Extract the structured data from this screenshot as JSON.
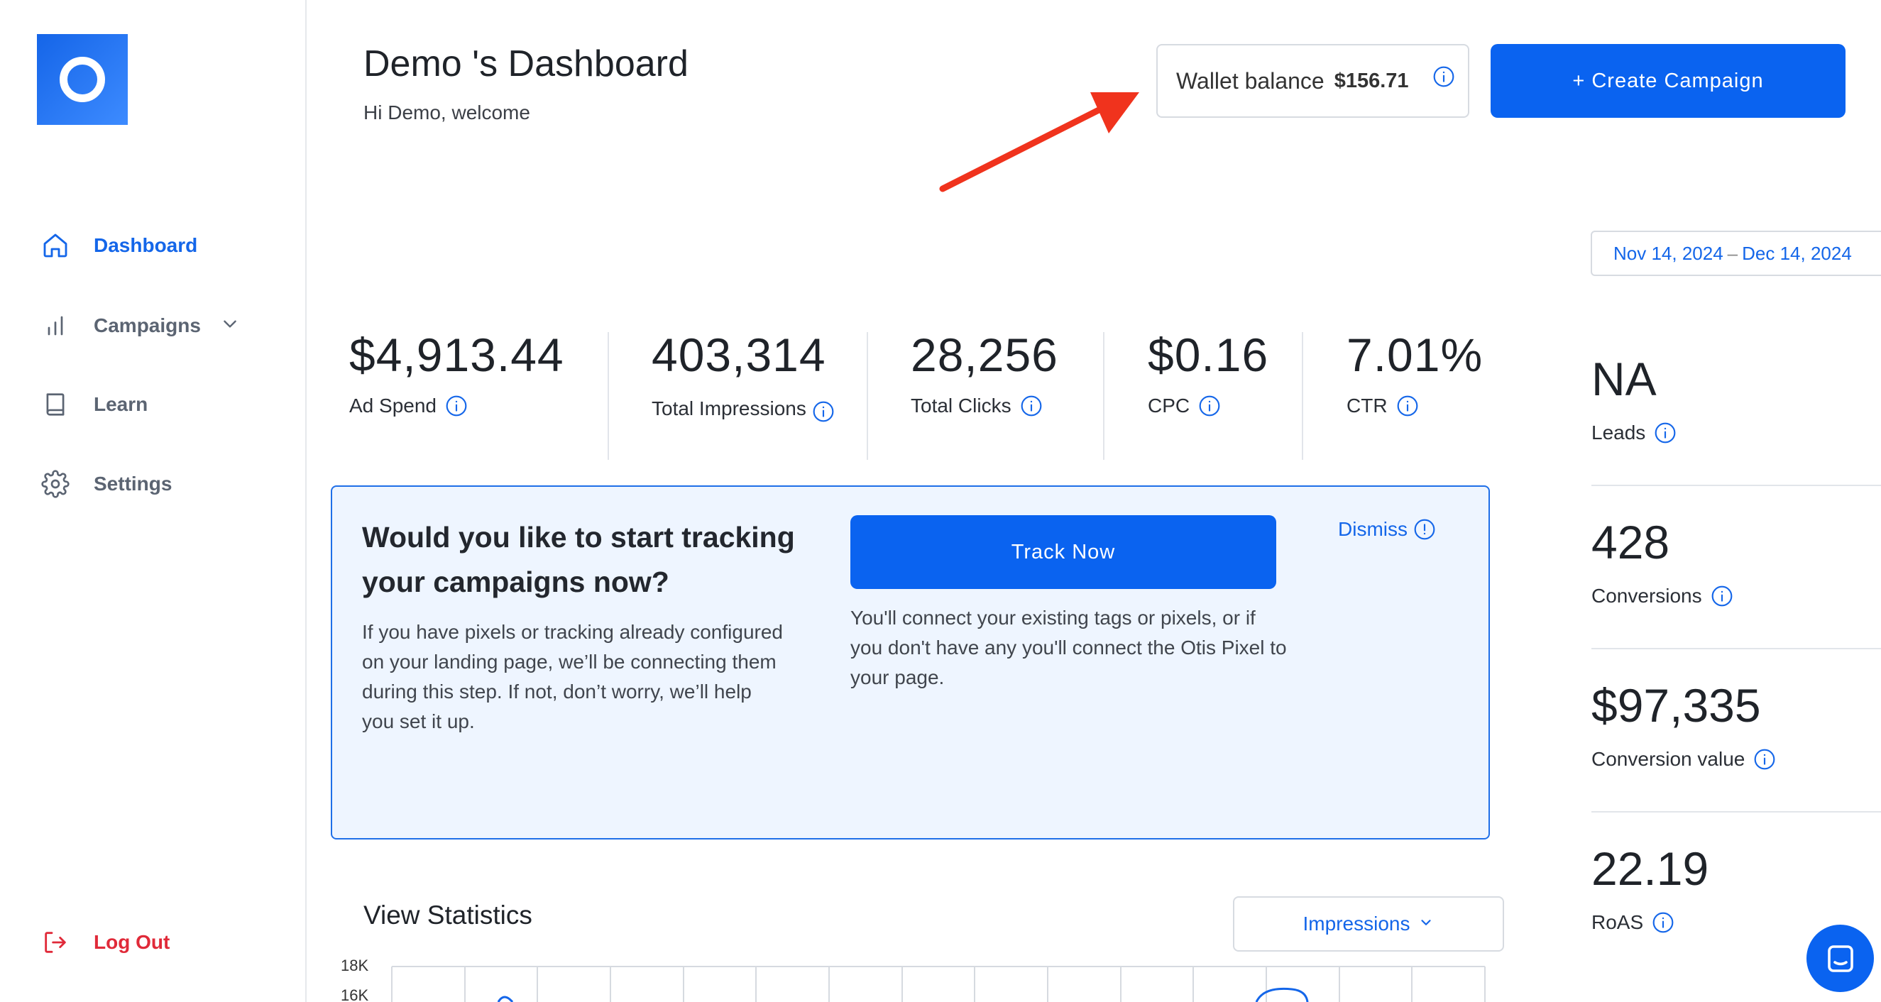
{
  "sidebar": {
    "items": [
      {
        "label": "Dashboard",
        "icon": "home-icon",
        "active": true
      },
      {
        "label": "Campaigns",
        "icon": "bar-chart-icon"
      },
      {
        "label": "Learn",
        "icon": "book-icon"
      },
      {
        "label": "Settings",
        "icon": "gear-icon"
      }
    ],
    "logout_label": "Log Out"
  },
  "header": {
    "title": "Demo 's Dashboard",
    "welcome": "Hi Demo, welcome",
    "wallet_label": "Wallet balance",
    "wallet_amount": "$156.71",
    "create_button": "+ Create Campaign"
  },
  "date_range": {
    "start": "Nov 14, 2024",
    "separator": "–",
    "end": "Dec 14, 2024"
  },
  "stats": [
    {
      "value": "$4,913.44",
      "label": "Ad Spend"
    },
    {
      "value": "403,314",
      "label": "Total Impressions"
    },
    {
      "value": "28,256",
      "label": "Total Clicks"
    },
    {
      "value": "$0.16",
      "label": "CPC"
    },
    {
      "value": "7.01%",
      "label": "CTR"
    }
  ],
  "side_stats": [
    {
      "value": "NA",
      "label": "Leads"
    },
    {
      "value": "428",
      "label": "Conversions"
    },
    {
      "value": "$97,335",
      "label": "Conversion value"
    },
    {
      "value": "22.19",
      "label": "RoAS"
    }
  ],
  "tracking": {
    "title": "Would you like to start tracking your campaigns now?",
    "description": "If you have pixels or tracking already configured on your landing page, we’ll be connecting them during this step. If not, don’t worry, we’ll help you set it up.",
    "button": "Track Now",
    "note": "You'll connect your existing tags or pixels, or if you don't have any you'll connect the Otis Pixel to your page.",
    "dismiss": "Dismiss"
  },
  "statistics": {
    "title": "View Statistics",
    "metric": "Impressions",
    "y_tick_top": "18K",
    "y_tick_second": "16K"
  },
  "colors": {
    "accent": "#0a63f0",
    "link": "#1466e9",
    "logout": "#e02a39",
    "annotation_arrow": "#f0331d"
  }
}
